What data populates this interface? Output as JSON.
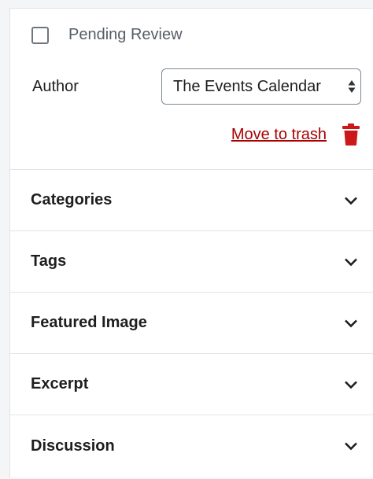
{
  "status": {
    "pending_review_label": "Pending Review",
    "pending_review_checked": false
  },
  "author": {
    "label": "Author",
    "selected": "The Events Calendar"
  },
  "trash": {
    "link_label": "Move to trash",
    "color": "#aa0000"
  },
  "sections": [
    {
      "title": "Categories",
      "icon": "chevron-down-icon"
    },
    {
      "title": "Tags",
      "icon": "chevron-down-icon"
    },
    {
      "title": "Featured Image",
      "icon": "chevron-down-icon"
    },
    {
      "title": "Excerpt",
      "icon": "chevron-down-icon"
    },
    {
      "title": "Discussion",
      "icon": "chevron-down-icon"
    }
  ]
}
